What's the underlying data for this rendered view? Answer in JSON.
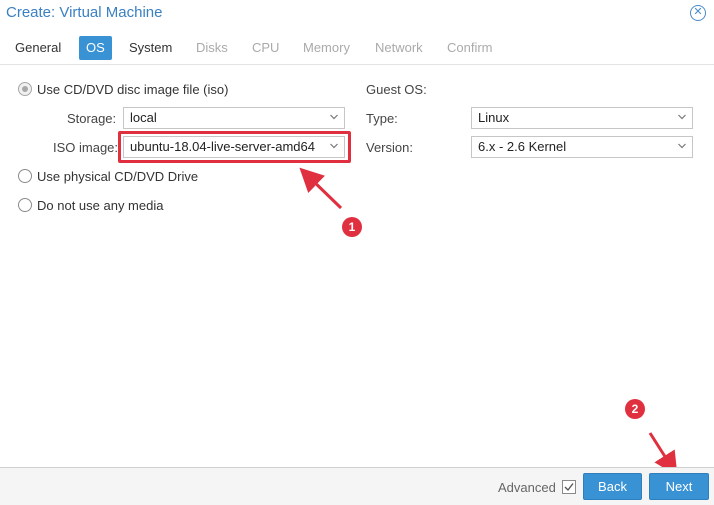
{
  "window": {
    "title": "Create: Virtual Machine",
    "close_symbol": "✕"
  },
  "tabs": [
    {
      "label": "General",
      "state": "normal"
    },
    {
      "label": "OS",
      "state": "active"
    },
    {
      "label": "System",
      "state": "normal"
    },
    {
      "label": "Disks",
      "state": "disabled"
    },
    {
      "label": "CPU",
      "state": "disabled"
    },
    {
      "label": "Memory",
      "state": "disabled"
    },
    {
      "label": "Network",
      "state": "disabled"
    },
    {
      "label": "Confirm",
      "state": "disabled"
    }
  ],
  "media": {
    "use_iso": {
      "label": "Use CD/DVD disc image file (iso)",
      "checked": true
    },
    "storage": {
      "label": "Storage:",
      "value": "local"
    },
    "iso_image": {
      "label": "ISO image:",
      "value": "ubuntu-18.04-live-server-amd64"
    },
    "use_physical": {
      "label": "Use physical CD/DVD Drive",
      "checked": false
    },
    "no_media": {
      "label": "Do not use any media",
      "checked": false
    }
  },
  "guest_os": {
    "heading": "Guest OS:",
    "type": {
      "label": "Type:",
      "value": "Linux"
    },
    "version": {
      "label": "Version:",
      "value": "6.x - 2.6 Kernel"
    }
  },
  "annotations": {
    "badge_1": "1",
    "badge_2": "2",
    "color": "#e0303f"
  },
  "footer": {
    "advanced_label": "Advanced",
    "advanced_checked": true,
    "back_label": "Back",
    "next_label": "Next"
  },
  "colors": {
    "accent": "#3892d4",
    "title": "#3a80c2",
    "annotation_red": "#e0303f"
  }
}
